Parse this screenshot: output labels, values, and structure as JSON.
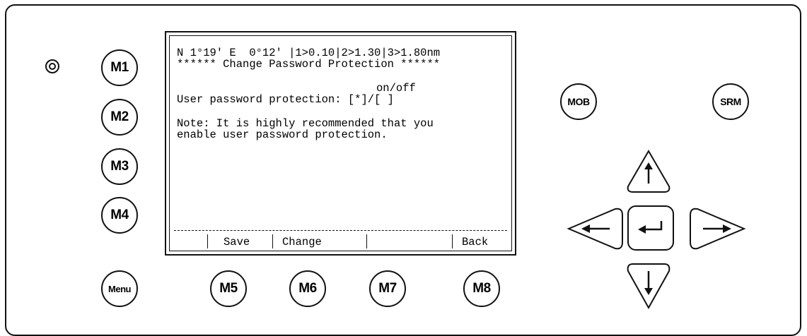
{
  "screen": {
    "header_line": "N 1°19' E  0°12' |1>0.10|2>1.30|3>1.80nm",
    "title_line": "****** Change Password Protection ******",
    "option_header": "on/off",
    "option_line": "User password protection: [*]/[ ]",
    "note_line1": "Note: It is highly recommended that you",
    "note_line2": "enable user password protection.",
    "softkeys": [
      "Save",
      "Change",
      "",
      "Back"
    ]
  },
  "buttons": {
    "m1": "M1",
    "m2": "M2",
    "m3": "M3",
    "m4": "M4",
    "m5": "M5",
    "m6": "M6",
    "m7": "M7",
    "m8": "M8",
    "menu": "Menu",
    "mob": "MOB",
    "srm": "SRM"
  },
  "icons": {
    "status_led": "led-ring-icon",
    "up": "arrow-up-icon",
    "down": "arrow-down-icon",
    "left": "arrow-left-icon",
    "right": "arrow-right-icon",
    "enter": "enter-return-icon"
  }
}
